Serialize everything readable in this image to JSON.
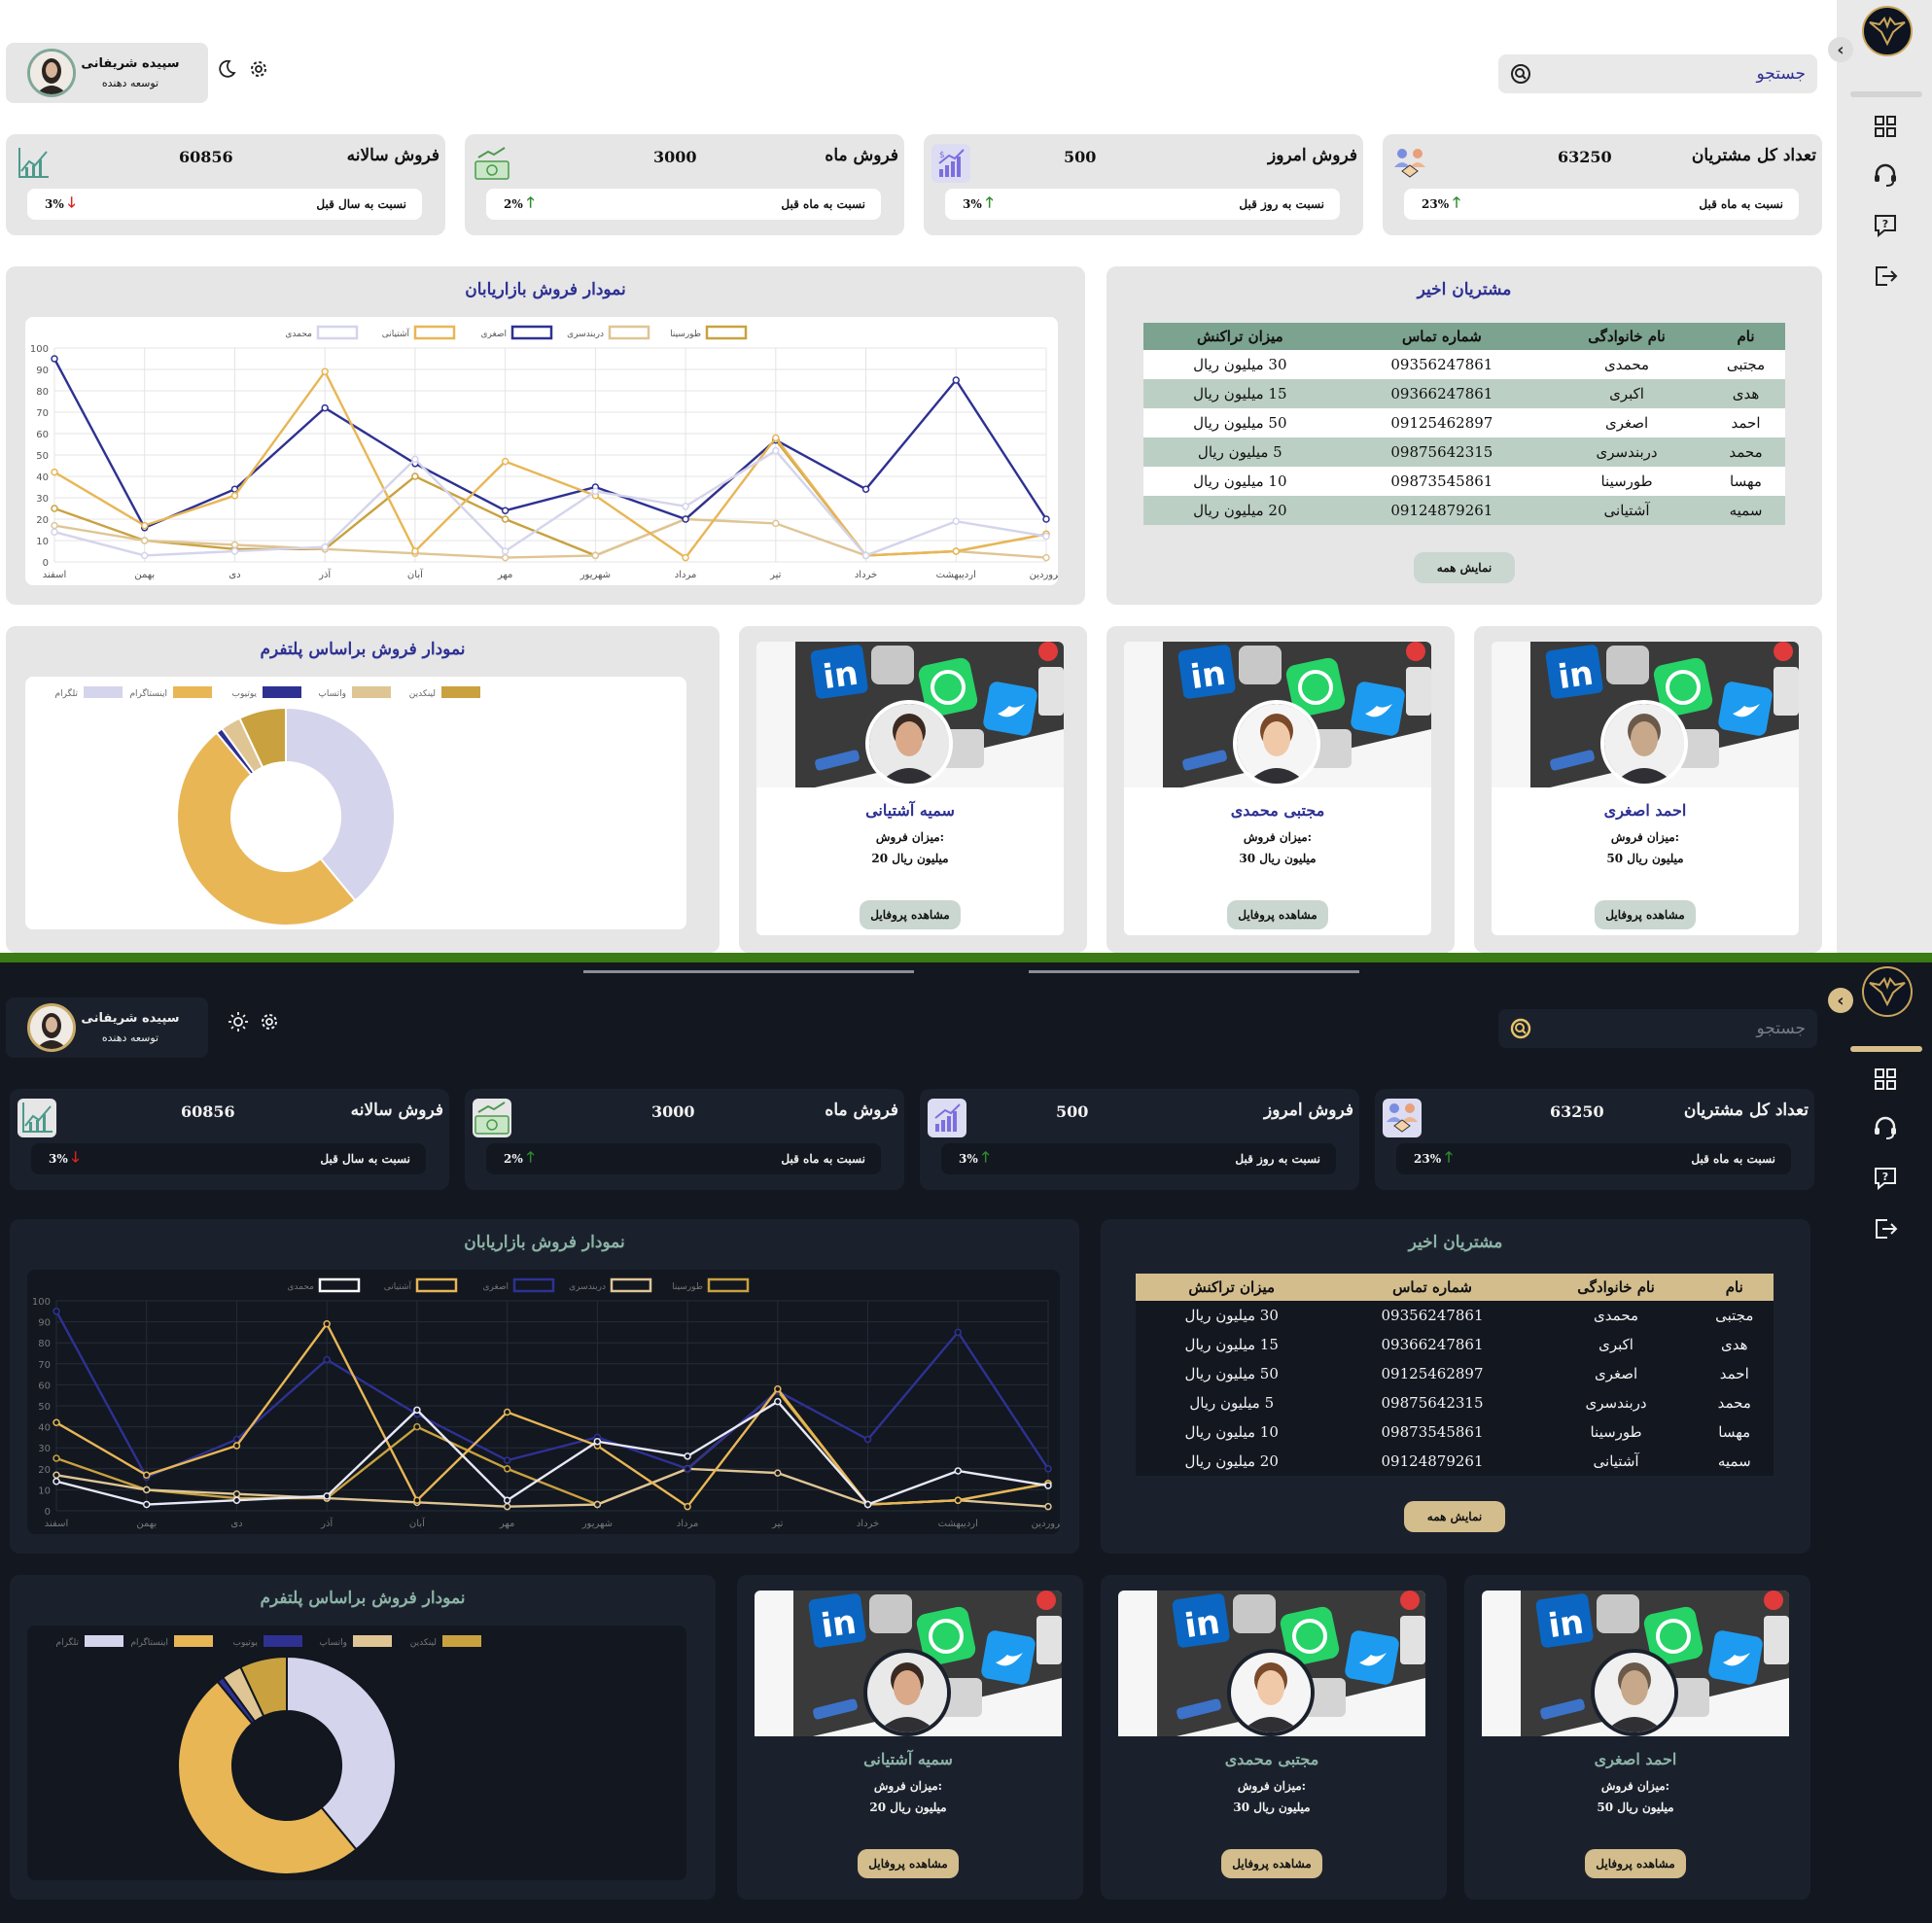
{
  "user": {
    "name": "سپیده شریفانی",
    "role": "توسعه دهنده"
  },
  "search": {
    "placeholder": "جستجو"
  },
  "stats": [
    {
      "title": "تعداد کل مشتریان",
      "value": "63250",
      "compare": "نسبت به ماه قبل",
      "change": "23%",
      "direction": "up",
      "icon": "customers-icon"
    },
    {
      "title": "فروش امروز",
      "value": "500",
      "compare": "نسبت به روز قبل",
      "change": "3%",
      "direction": "up",
      "icon": "sales-growth-icon"
    },
    {
      "title": "فروش ماه",
      "value": "3000",
      "compare": "نسبت به ماه قبل",
      "change": "2%",
      "direction": "up",
      "icon": "money-icon"
    },
    {
      "title": "فروش سالانه",
      "value": "60856",
      "compare": "نسبت به سال قبل",
      "change": "3%",
      "direction": "down",
      "icon": "line-chart-icon"
    }
  ],
  "customers": {
    "title": "مشتریان اخیر",
    "columns": [
      "نام",
      "نام خانوادگی",
      "شماره تماس",
      "میزان تراکنش"
    ],
    "rows": [
      [
        "مجتبی",
        "محمدی",
        "09356247861",
        "30 میلیون ریال"
      ],
      [
        "هدی",
        "اکبری",
        "09366247861",
        "15 میلیون ریال"
      ],
      [
        "احمد",
        "اصغری",
        "09125462897",
        "50 میلیون ریال"
      ],
      [
        "محمد",
        "دربندسری",
        "09875642315",
        "5 میلیون ریال"
      ],
      [
        "مهسا",
        "طورسینا",
        "09873545861",
        "10 میلیون ریال"
      ],
      [
        "سمیه",
        "آشتیانی",
        "09124879261",
        "20 میلیون ریال"
      ]
    ],
    "show_all": "نمایش همه"
  },
  "sellers": [
    {
      "name": "احمد اصغری",
      "label": "میزان فروش:",
      "sales": "50 میلیون ریال",
      "button": "مشاهده پروفایل"
    },
    {
      "name": "مجتبی محمدی",
      "label": "میزان فروش:",
      "sales": "30 میلیون ریال",
      "button": "مشاهده پروفایل"
    },
    {
      "name": "سمیه آشتیانی",
      "label": "میزان فروش:",
      "sales": "20 میلیون ریال",
      "button": "مشاهده پروفایل"
    }
  ],
  "colors": {
    "navy": "#2e3192",
    "gold": "#e8b655",
    "light_lavender": "#d4d4ec",
    "beige": "#dfc594",
    "dark_gold": "#c9a23f",
    "up": "#2e8b2e",
    "down": "#e02020",
    "light_header_green": "#7ba38f",
    "dark_accent": "#d3bd8d"
  },
  "chart_data": [
    {
      "type": "line",
      "title": "نمودار فروش بازاریابان",
      "x": [
        "فروردین",
        "اردیبهشت",
        "خرداد",
        "تیر",
        "مرداد",
        "شهریور",
        "مهر",
        "آبان",
        "آذر",
        "دی",
        "بهمن",
        "اسفند"
      ],
      "ylim": [
        0,
        100
      ],
      "yticks": [
        0,
        10,
        20,
        30,
        40,
        50,
        60,
        70,
        80,
        90,
        100
      ],
      "legend_position": "top",
      "grid": true,
      "series": [
        {
          "name": "طورسینا",
          "color": "#c9a23f",
          "values": [
            13,
            5,
            3,
            57,
            20,
            3,
            20,
            40,
            6,
            6,
            10,
            25
          ]
        },
        {
          "name": "دربندسری",
          "color": "#dfc594",
          "values": [
            2,
            5,
            3,
            18,
            20,
            3,
            2,
            4,
            6,
            8,
            10,
            17
          ]
        },
        {
          "name": "اصغری",
          "color": "#2e3192",
          "values": [
            20,
            85,
            34,
            57,
            20,
            35,
            24,
            46,
            72,
            34,
            16,
            95
          ]
        },
        {
          "name": "آشتیانی",
          "color": "#e8b655",
          "values": [
            13,
            5,
            3,
            58,
            2,
            31,
            47,
            5,
            89,
            31,
            17,
            42
          ]
        },
        {
          "name": "محمدی",
          "color": "#d4d4ec",
          "values": [
            12,
            19,
            3,
            52,
            26,
            33,
            5,
            48,
            7,
            5,
            3,
            14
          ]
        }
      ]
    },
    {
      "type": "pie",
      "donut": true,
      "title": "نمودار فروش براساس پلتفرم",
      "legend_position": "top",
      "categories": [
        "لینکدین",
        "واتساپ",
        "یوتیوب",
        "اینستاگرام",
        "تلگرام"
      ],
      "colors": [
        "#c9a23f",
        "#dfc594",
        "#2e3192",
        "#e8b655",
        "#d4d4ec"
      ],
      "values": [
        7,
        3,
        1,
        50,
        39
      ]
    }
  ]
}
